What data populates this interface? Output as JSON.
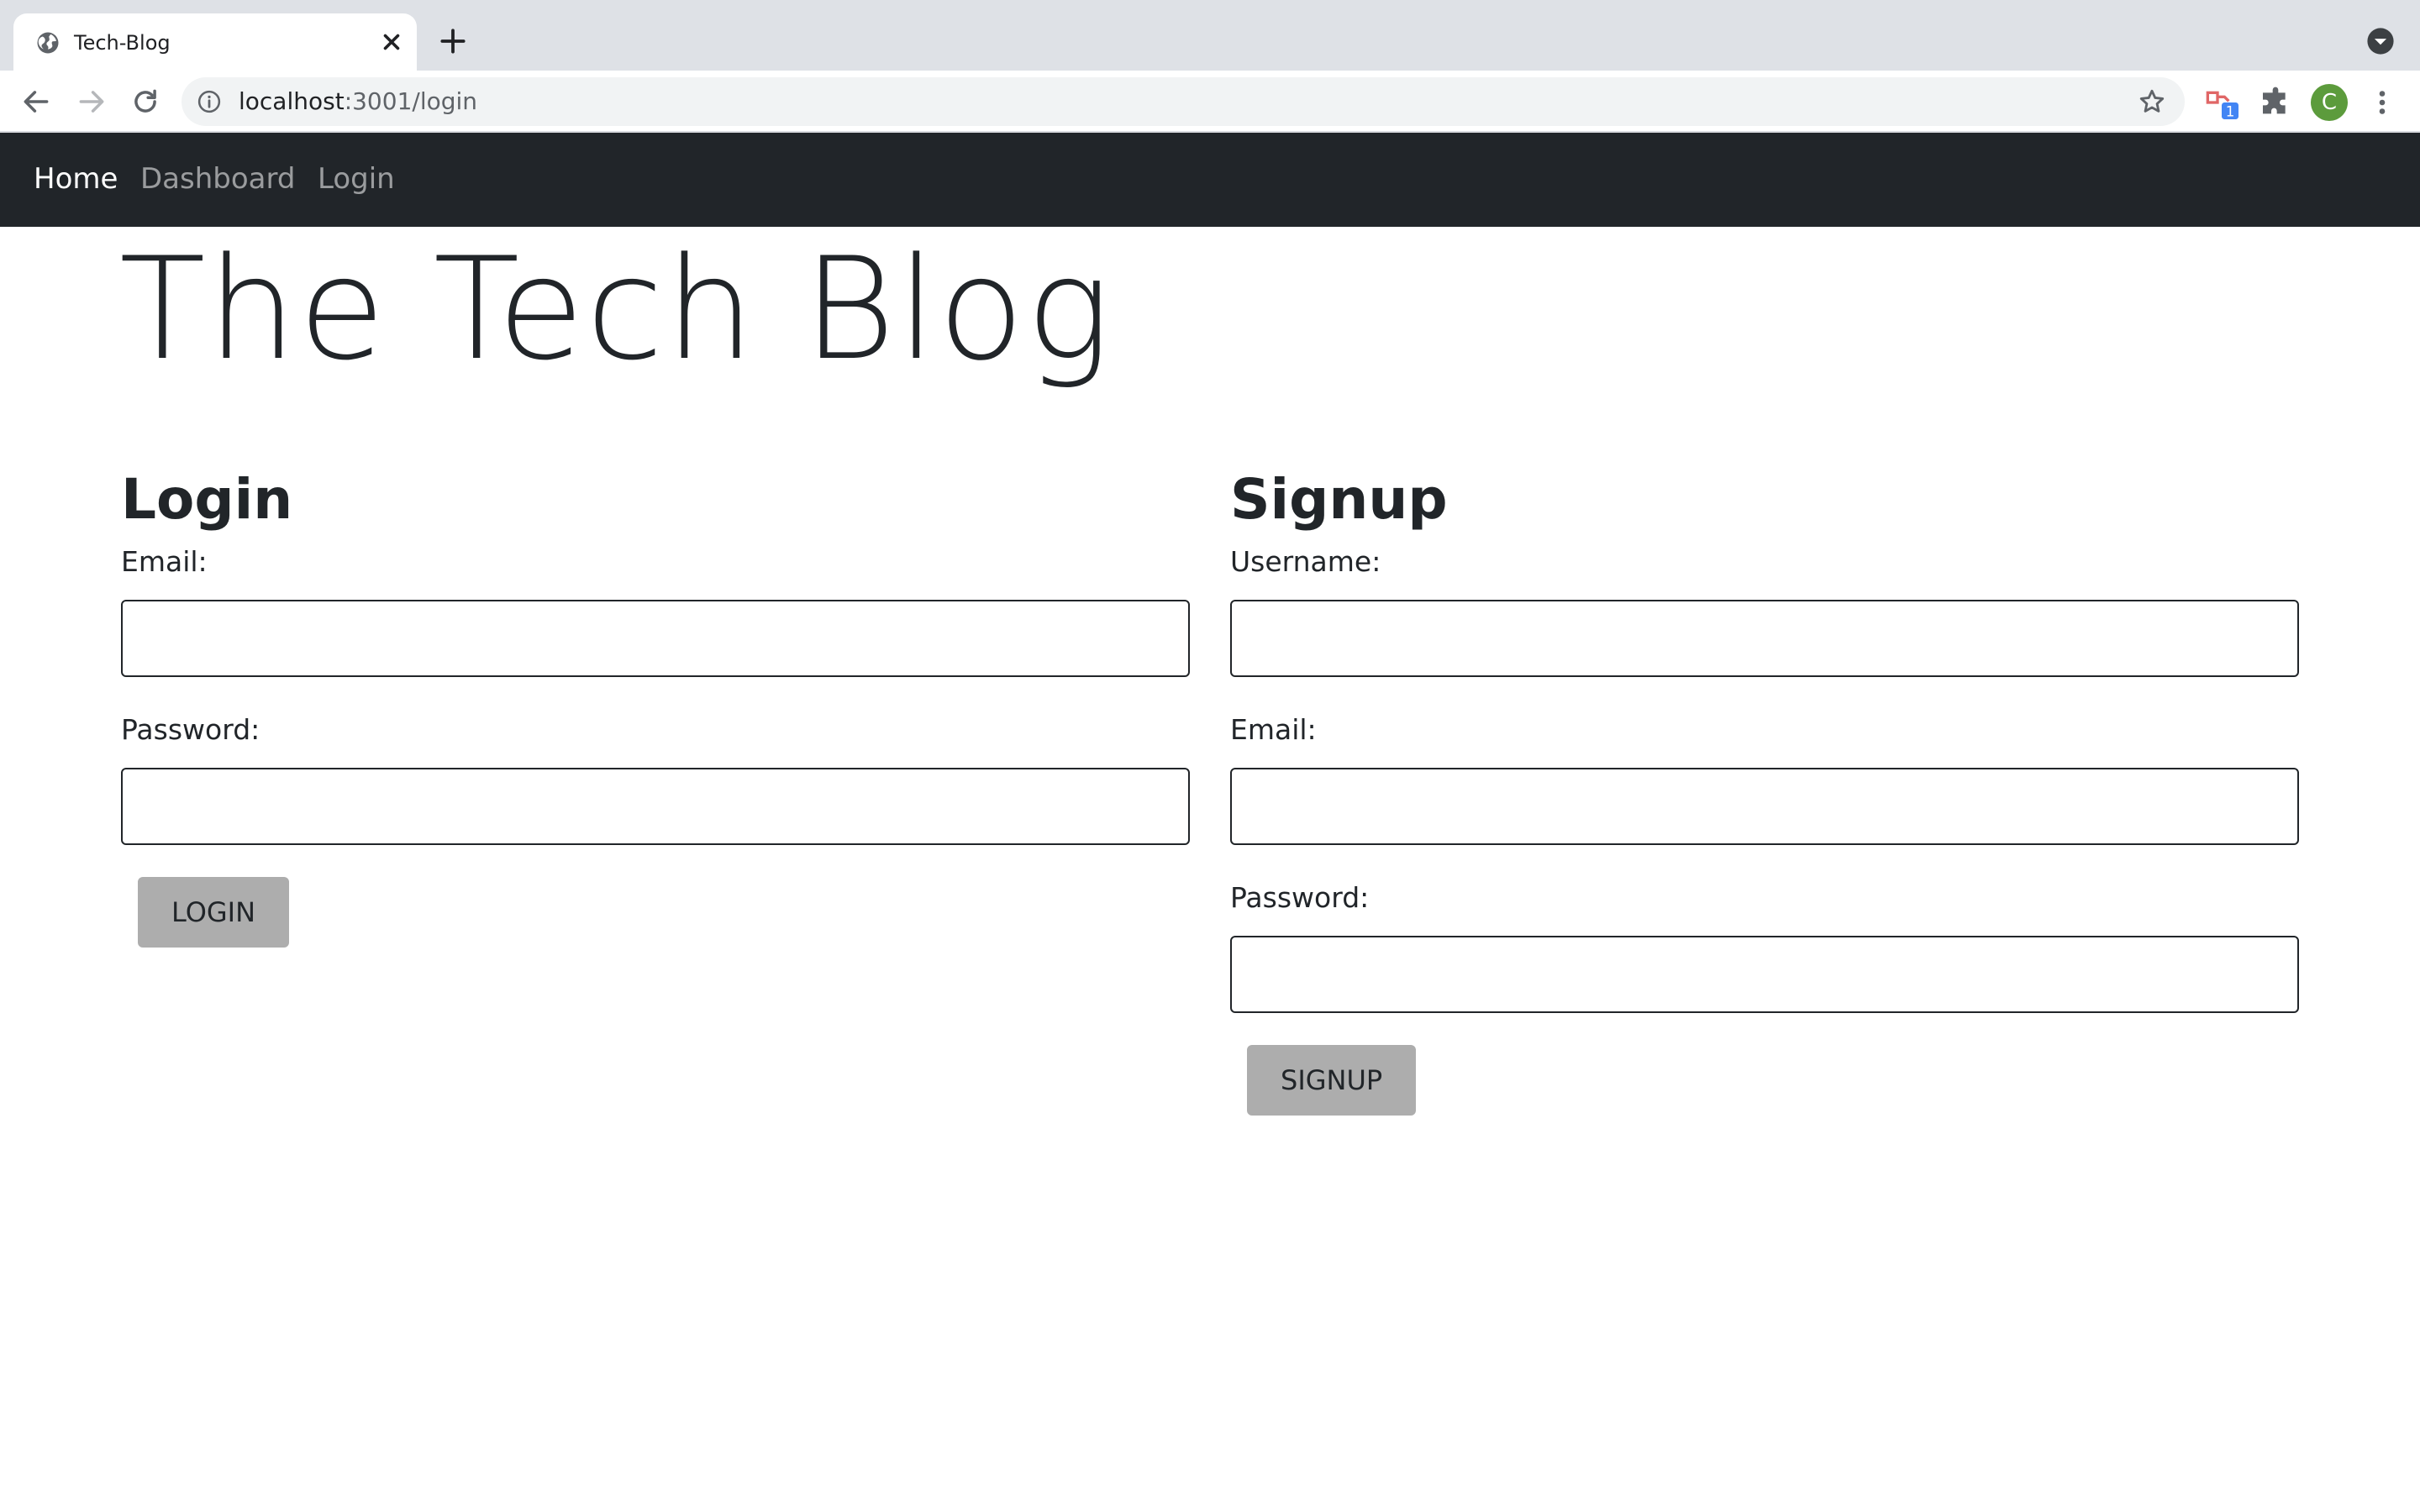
{
  "browser": {
    "tab_title": "Tech-Blog",
    "url_host": "localhost",
    "url_rest": ":3001/login",
    "profile_initial": "C",
    "extension_badge": "1"
  },
  "navbar": {
    "links": [
      {
        "label": "Home",
        "active": true
      },
      {
        "label": "Dashboard",
        "active": false
      },
      {
        "label": "Login",
        "active": false
      }
    ]
  },
  "hero": {
    "title": "The Tech Blog"
  },
  "login": {
    "heading": "Login",
    "email_label": "Email:",
    "email_value": "",
    "password_label": "Password:",
    "password_value": "",
    "button": "LOGIN"
  },
  "signup": {
    "heading": "Signup",
    "username_label": "Username:",
    "username_value": "",
    "email_label": "Email:",
    "email_value": "",
    "password_label": "Password:",
    "password_value": "",
    "button": "SIGNUP"
  },
  "colors": {
    "navbar_bg": "#212529",
    "button_bg": "#adadad",
    "tabstrip_bg": "#dee1e6"
  }
}
